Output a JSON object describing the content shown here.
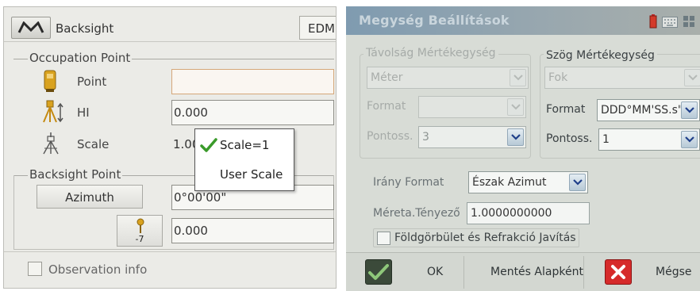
{
  "left": {
    "title": "Backsight",
    "menu_icon": "m-logo-icon",
    "edm_label": "EDM",
    "occupation": {
      "group_label": "Occupation Point",
      "point_label": "Point",
      "point_value": "",
      "hi_label": "HI",
      "hi_value": "0.000",
      "scale_label": "Scale",
      "scale_value": "1.00"
    },
    "scale_popup": {
      "options": [
        "Scale=1",
        "User Scale"
      ],
      "selected": "Scale=1",
      "check_color": "#3a9a2a"
    },
    "backsight": {
      "group_label": "Backsight Point",
      "azimuth_label": "Azimuth",
      "azimuth_value": "0°00'00\"",
      "prism_constant": "-7",
      "prism_value": "0.000"
    },
    "observation_info": {
      "label": "Observation info",
      "checked": false
    }
  },
  "right": {
    "title": "Megység Beállítások",
    "status_icons": [
      "battery-icon",
      "keyboard-icon",
      "grid-icon"
    ],
    "distance": {
      "group_label": "Távolság Mértékegység",
      "unit_value": "Méter",
      "format_label": "Format",
      "format_value": "",
      "precision_label": "Pontoss.",
      "precision_value": "3"
    },
    "angle": {
      "group_label": "Szög Mértékegység",
      "unit_value": "Fok",
      "format_label": "Format",
      "format_value": "DDD°MM'SS.s\"",
      "precision_label": "Pontoss.",
      "precision_value": "1"
    },
    "direction": {
      "label": "Irány Format",
      "value": "Észak Azimut"
    },
    "scale_factor": {
      "label": "Méreta.Tényező",
      "value": "1.0000000000"
    },
    "curvature": {
      "label": "Földgörbület és Refrakció Javítás",
      "checked": false
    },
    "buttons": {
      "ok": "OK",
      "save_default": "Mentés Alapként",
      "cancel": "Mégse"
    },
    "colors": {
      "ok_green": "#3a9a2a",
      "cancel_red": "#d62b2b",
      "title_bar": "#8aa1b2"
    }
  }
}
